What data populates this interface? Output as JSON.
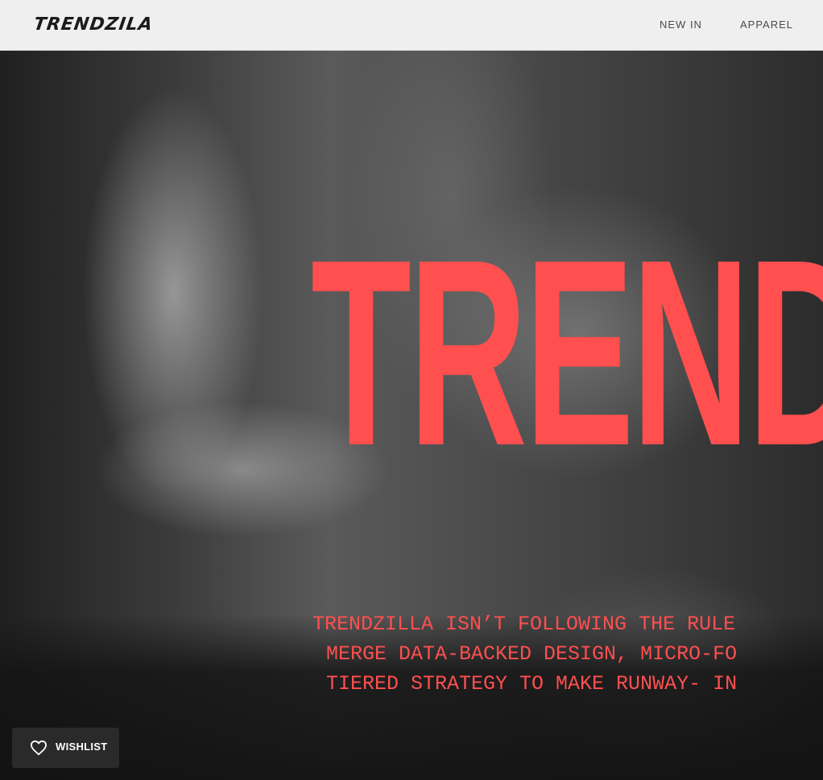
{
  "header": {
    "logo_text": "TRENDZILA",
    "nav": [
      {
        "label": "NEW IN"
      },
      {
        "label": "APPAREL"
      }
    ]
  },
  "hero": {
    "headline": "TREND",
    "tagline": [
      "TRENDZILLA ISN’T FOLLOWING THE RULE",
      "MERGE DATA-BACKED DESIGN, MICRO-FO",
      "TIERED STRATEGY TO MAKE RUNWAY- IN"
    ],
    "accent_color": "#ff4f4f"
  },
  "wishlist": {
    "label": "WISHLIST",
    "icon": "heart-icon"
  }
}
